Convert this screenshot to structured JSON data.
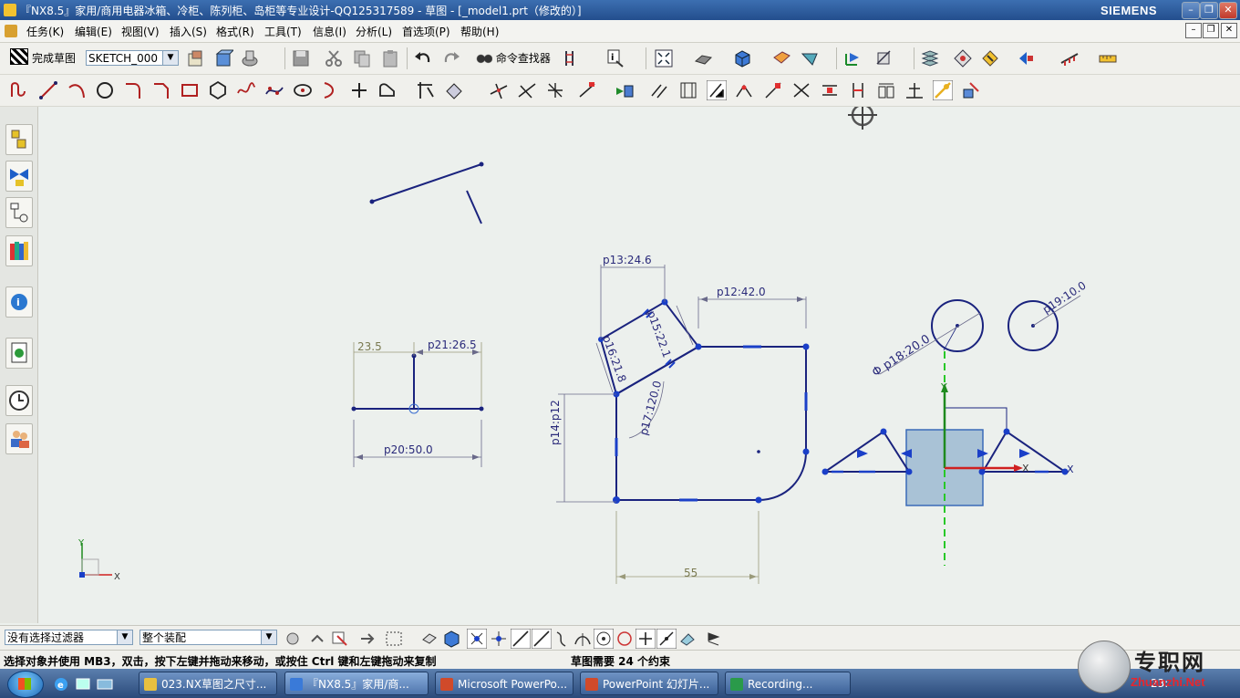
{
  "window": {
    "title": "『NX8.5』家用/商用电器冰箱、冷柜、陈列柜、岛柜等专业设计-QQ125317589 - 草图 - [_model1.prt（修改的）]",
    "brand": "SIEMENS"
  },
  "menu": {
    "items": [
      "任务(K)",
      "编辑(E)",
      "视图(V)",
      "插入(S)",
      "格式(R)",
      "工具(T)",
      "信息(I)",
      "分析(L)",
      "首选项(P)",
      "帮助(H)"
    ]
  },
  "toolbar": {
    "finish_sketch": "完成草图",
    "sketch_name": "SKETCH_000",
    "command_finder": "命令查找器"
  },
  "sketch": {
    "dims": {
      "d1": "23.5",
      "d2": "p21:26.5",
      "d3": "p20:50.0",
      "d4": "p13:24.6",
      "d5": "p12:42.0",
      "d6": "p15:22.1",
      "d7": "p16:21.8",
      "d8": "p17:120.0",
      "d9": "p14:p12",
      "d10": "55",
      "d11": "Φ p18:20.0",
      "d12": "p19:10.0"
    },
    "axis": {
      "x": "X",
      "y": "Y"
    }
  },
  "bottom": {
    "filter": "没有选择过滤器",
    "scope": "整个装配"
  },
  "status": {
    "prompt": "选择对象并使用 MB3，双击，按下左键并拖动来移动，或按住 Ctrl 键和左键拖动来复制",
    "constraints": "草图需要 24 个约束"
  },
  "taskbar": {
    "items": [
      "023.NX草图之尺寸...",
      "『NX8.5』家用/商...",
      "Microsoft PowerPo...",
      "PowerPoint 幻灯片...",
      "Recording..."
    ],
    "time": "23:"
  },
  "watermark": {
    "cn": "专职网",
    "en": "Zhuanzhi.Net"
  }
}
